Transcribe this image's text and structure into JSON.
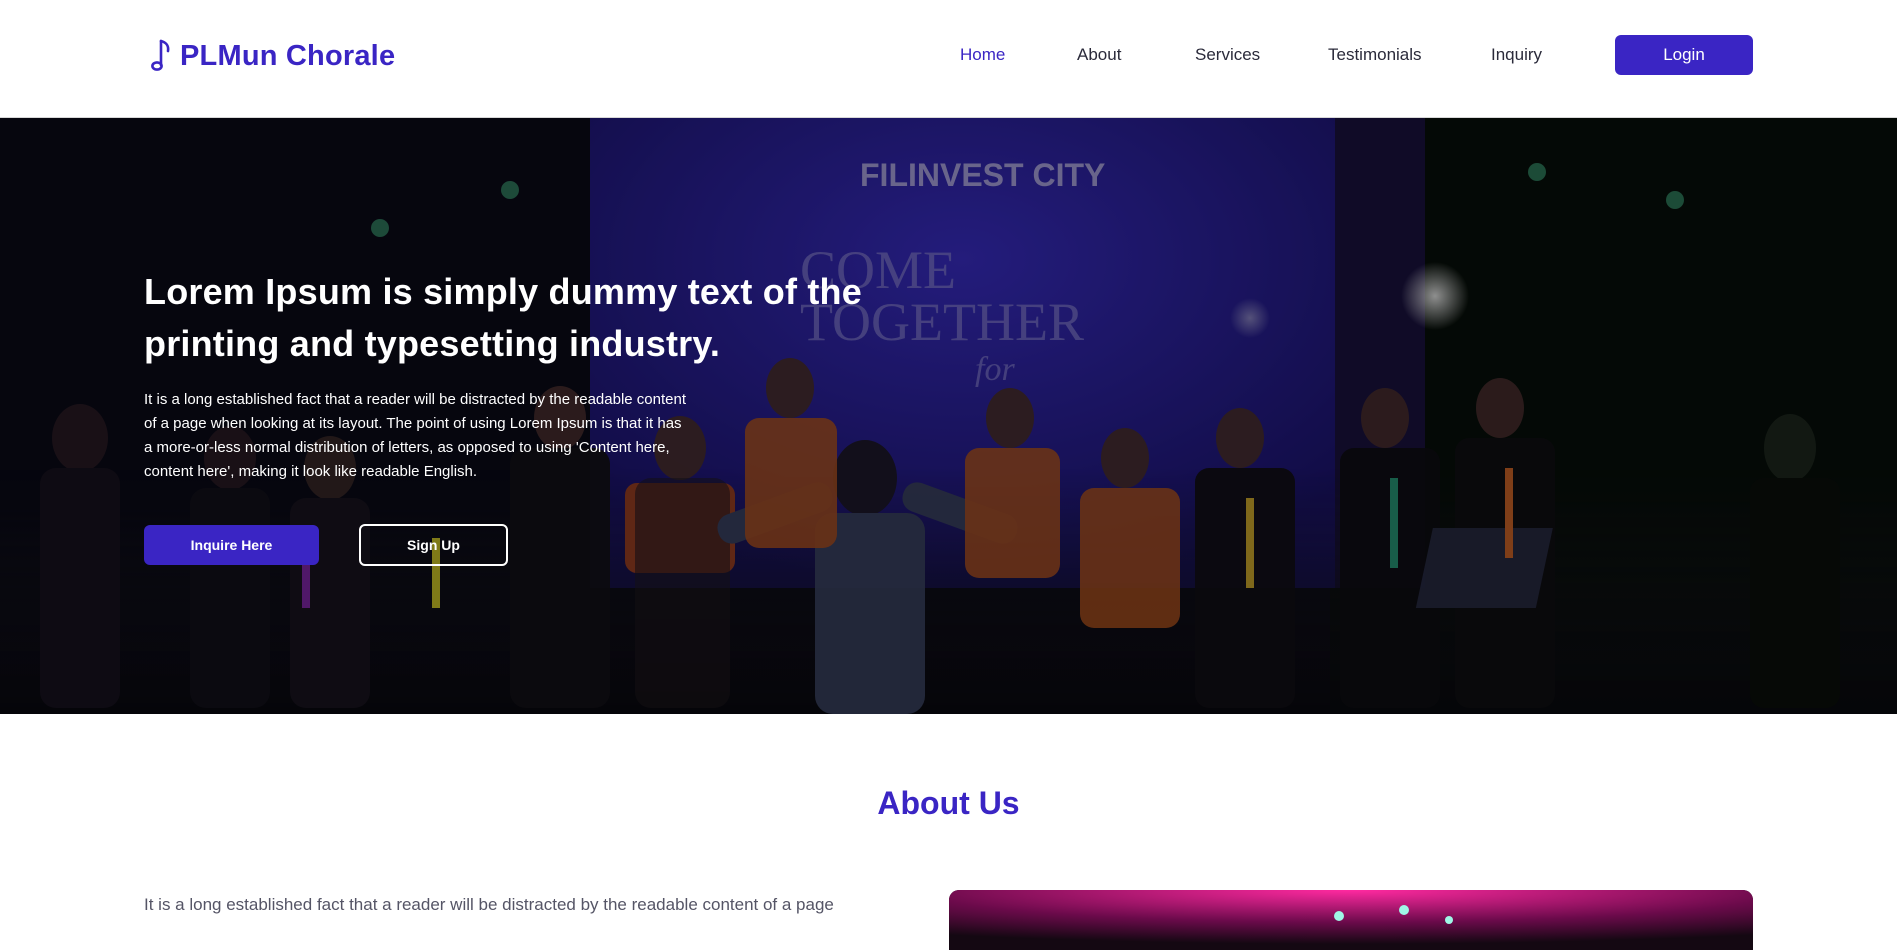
{
  "brand": {
    "name": "PLMun Chorale",
    "icon": "music-note-icon",
    "color": "#3a25c4"
  },
  "nav": {
    "items": [
      {
        "label": "Home",
        "active": true
      },
      {
        "label": "About",
        "active": false
      },
      {
        "label": "Services",
        "active": false
      },
      {
        "label": "Testimonials",
        "active": false
      },
      {
        "label": "Inquiry",
        "active": false
      }
    ],
    "login_label": "Login"
  },
  "hero": {
    "title": "Lorem Ipsum is simply dummy text of the printing and typesetting industry.",
    "text": "It is a long established fact that a reader will be distracted by the readable content of a page when looking at its layout. The point of using Lorem Ipsum is that it has a more-or-less normal distribution of letters, as opposed to using 'Content here, content here', making it look like readable English.",
    "primary_label": "Inquire Here",
    "secondary_label": "Sign Up",
    "banner_text_1": "FILINVEST CITY",
    "banner_text_2": "COME",
    "banner_text_3": "TOGETHER",
    "banner_text_4": "for"
  },
  "about": {
    "title": "About Us",
    "text": "It is a long established fact that a reader will be distracted by the readable content of a page"
  },
  "colors": {
    "accent": "#3a25c4",
    "nav_text": "#2a2a3a",
    "hero_banner": "#2a1fa8"
  }
}
